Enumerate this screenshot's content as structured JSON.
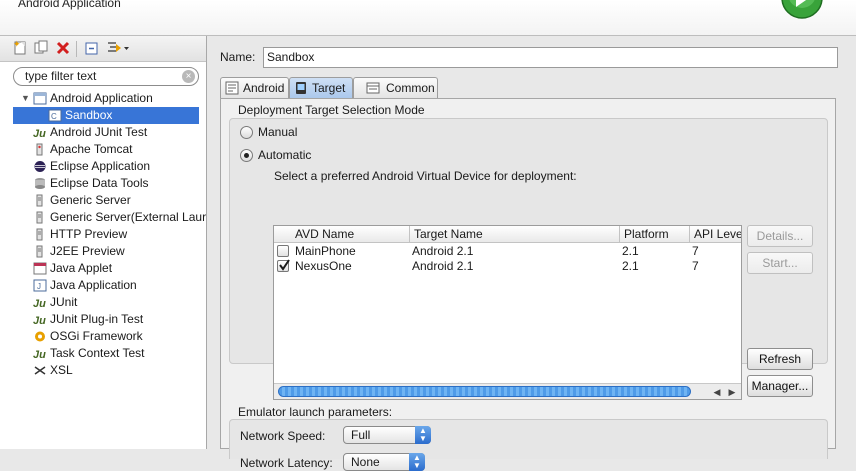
{
  "header": {
    "title": "Android Application"
  },
  "left": {
    "toolbar": [
      "new-config-icon",
      "duplicate-icon",
      "delete-icon",
      "collapse-all-icon",
      "filter-icon"
    ],
    "filter": {
      "value": "type filter text"
    },
    "tree": [
      {
        "label": "Android Application",
        "icon": "android-app-icon",
        "level": 0,
        "expanded": true
      },
      {
        "label": "Sandbox",
        "icon": "launch-config-icon",
        "level": 1,
        "selected": true
      },
      {
        "label": "Android JUnit Test",
        "icon": "junit-icon",
        "level": 0
      },
      {
        "label": "Apache Tomcat",
        "icon": "tomcat-icon",
        "level": 0
      },
      {
        "label": "Eclipse Application",
        "icon": "eclipse-icon",
        "level": 0
      },
      {
        "label": "Eclipse Data Tools",
        "icon": "database-icon",
        "level": 0
      },
      {
        "label": "Generic Server",
        "icon": "server-icon",
        "level": 0
      },
      {
        "label": "Generic Server(External Laur",
        "icon": "server-icon",
        "level": 0
      },
      {
        "label": "HTTP Preview",
        "icon": "server-icon",
        "level": 0
      },
      {
        "label": "J2EE Preview",
        "icon": "server-icon",
        "level": 0
      },
      {
        "label": "Java Applet",
        "icon": "applet-icon",
        "level": 0
      },
      {
        "label": "Java Application",
        "icon": "java-app-icon",
        "level": 0
      },
      {
        "label": "JUnit",
        "icon": "junit-icon",
        "level": 0
      },
      {
        "label": "JUnit Plug-in Test",
        "icon": "junit-icon",
        "level": 0
      },
      {
        "label": "OSGi Framework",
        "icon": "osgi-icon",
        "level": 0
      },
      {
        "label": "Task Context Test",
        "icon": "junit-icon",
        "level": 0
      },
      {
        "label": "XSL",
        "icon": "xsl-icon",
        "level": 0
      }
    ]
  },
  "right": {
    "name_label": "Name:",
    "name_value": "Sandbox",
    "tabs": [
      {
        "label": "Android",
        "icon": "android-tab-icon"
      },
      {
        "label": "Target",
        "icon": "target-tab-icon",
        "active": true
      },
      {
        "label": "Common",
        "icon": "common-tab-icon"
      }
    ],
    "deploy": {
      "title": "Deployment Target Selection Mode",
      "manual": "Manual",
      "automatic": "Automatic",
      "selected": "automatic",
      "prompt": "Select a preferred Android Virtual Device for deployment:"
    },
    "avd_table": {
      "columns": [
        "AVD Name",
        "Target Name",
        "Platform",
        "API Level"
      ],
      "rows": [
        {
          "checked": false,
          "name": "MainPhone",
          "target": "Android 2.1",
          "platform": "2.1",
          "api": "7"
        },
        {
          "checked": true,
          "name": "NexusOne",
          "target": "Android 2.1",
          "platform": "2.1",
          "api": "7"
        }
      ]
    },
    "buttons": {
      "details": "Details...",
      "start": "Start...",
      "refresh": "Refresh",
      "manager": "Manager..."
    },
    "emulator": {
      "title": "Emulator launch parameters:",
      "network_speed_label": "Network Speed:",
      "network_speed_value": "Full",
      "network_latency_label": "Network Latency:",
      "network_latency_value": "None"
    }
  },
  "colors": {
    "selection": "#3875d7",
    "active_tab": "#a9c7ec",
    "scroll_thumb": "#4f9be8"
  }
}
